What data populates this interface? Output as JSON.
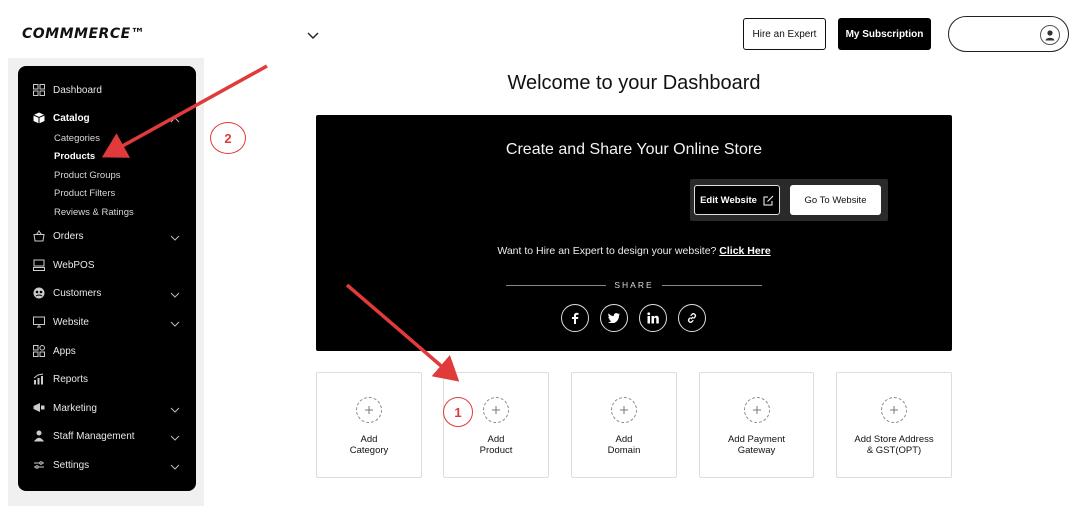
{
  "header": {
    "logo": "COMMMERCE™",
    "hire_label": "Hire an Expert",
    "subscription_label": "My Subscription"
  },
  "sidebar": {
    "items": [
      {
        "label": "Dashboard",
        "icon": "grid-icon"
      },
      {
        "label": "Catalog",
        "icon": "box-icon",
        "expanded": true
      },
      {
        "label": "Orders",
        "icon": "basket-icon"
      },
      {
        "label": "WebPOS",
        "icon": "pos-icon"
      },
      {
        "label": "Customers",
        "icon": "customers-icon"
      },
      {
        "label": "Website",
        "icon": "monitor-icon"
      },
      {
        "label": "Apps",
        "icon": "apps-icon"
      },
      {
        "label": "Reports",
        "icon": "chart-icon"
      },
      {
        "label": "Marketing",
        "icon": "megaphone-icon"
      },
      {
        "label": "Staff Management",
        "icon": "staff-icon"
      },
      {
        "label": "Settings",
        "icon": "settings-icon"
      }
    ],
    "catalog_sub": [
      "Categories",
      "Products",
      "Product Groups",
      "Product Filters",
      "Reviews & Ratings"
    ]
  },
  "main": {
    "welcome": "Welcome to your Dashboard",
    "hero": {
      "title": "Create and Share Your Online Store",
      "edit_label": "Edit Website",
      "go_label": "Go To Website",
      "hire_text": "Want to Hire an Expert to design your website?",
      "hire_link": "Click Here",
      "share_label": "SHARE"
    },
    "cards": [
      "Add\nCategory",
      "Add\nProduct",
      "Add\nDomain",
      "Add Payment\nGateway",
      "Add Store Address\n& GST(OPT)"
    ]
  },
  "annotations": {
    "one": "1",
    "two": "2"
  },
  "colors": {
    "accent": "#000000",
    "annotation": "#e03a3a"
  }
}
